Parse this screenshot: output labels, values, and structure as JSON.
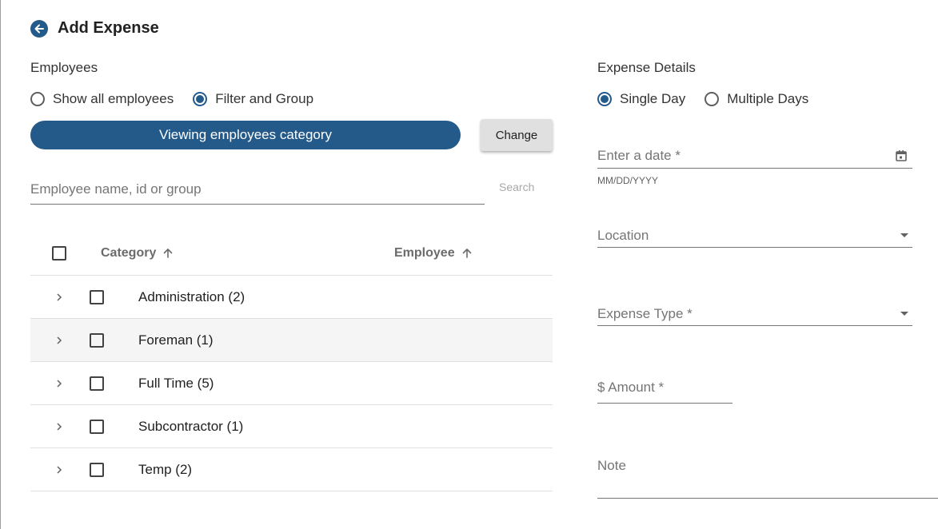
{
  "header": {
    "title": "Add Expense"
  },
  "employees": {
    "label": "Employees",
    "options": [
      {
        "label": "Show all employees",
        "checked": false
      },
      {
        "label": "Filter and Group",
        "checked": true
      }
    ],
    "viewing_label": "Viewing employees category",
    "change_label": "Change",
    "search_placeholder": "Employee name, id or group",
    "search_label": "Search",
    "table": {
      "columns": [
        "Category",
        "Employee"
      ],
      "rows": [
        {
          "label": "Administration (2)"
        },
        {
          "label": "Foreman (1)"
        },
        {
          "label": "Full Time (5)"
        },
        {
          "label": "Subcontractor (1)"
        },
        {
          "label": "Temp (2)"
        }
      ]
    }
  },
  "expense": {
    "label": "Expense Details",
    "options": [
      {
        "label": "Single Day",
        "checked": true
      },
      {
        "label": "Multiple Days",
        "checked": false
      }
    ],
    "date_placeholder": "Enter a date *",
    "date_hint": "MM/DD/YYYY",
    "location_placeholder": "Location",
    "type_placeholder": "Expense Type *",
    "amount_placeholder": "$ Amount *",
    "note_placeholder": "Note"
  },
  "colors": {
    "primary": "#245a8a"
  }
}
